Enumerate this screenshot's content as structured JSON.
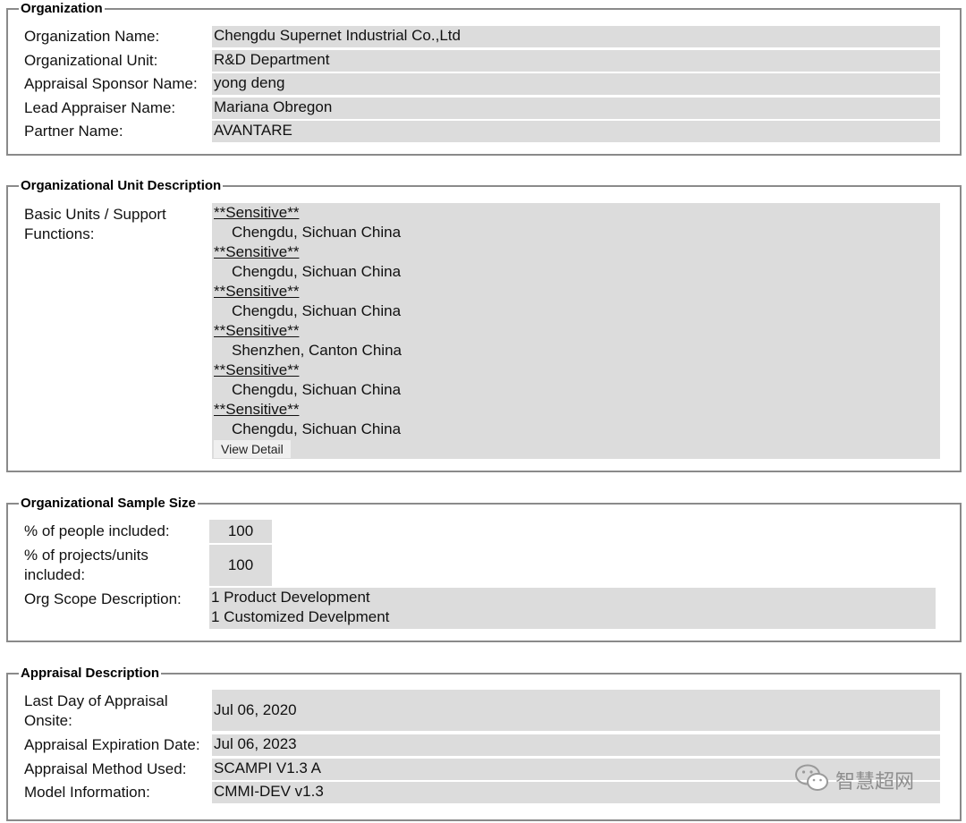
{
  "organization": {
    "legend": "Organization",
    "rows": [
      {
        "label": "Organization Name:",
        "value": "Chengdu Supernet Industrial Co.,Ltd"
      },
      {
        "label": "Organizational Unit:",
        "value": "R&D Department"
      },
      {
        "label": "Appraisal Sponsor Name:",
        "value": "yong deng"
      },
      {
        "label": "Lead Appraiser Name:",
        "value": "Mariana Obregon"
      },
      {
        "label": "Partner Name:",
        "value": "AVANTARE"
      }
    ]
  },
  "unit_description": {
    "legend": "Organizational Unit Description",
    "label": "Basic Units / Support Functions:",
    "units": [
      {
        "name": "**Sensitive**",
        "location": "Chengdu, Sichuan China"
      },
      {
        "name": "**Sensitive**",
        "location": "Chengdu, Sichuan China"
      },
      {
        "name": "**Sensitive**",
        "location": "Chengdu, Sichuan China"
      },
      {
        "name": "**Sensitive**",
        "location": "Shenzhen, Canton China"
      },
      {
        "name": "**Sensitive**",
        "location": "Chengdu, Sichuan China"
      },
      {
        "name": "**Sensitive**",
        "location": "Chengdu, Sichuan China"
      }
    ],
    "view_detail_label": "View Detail"
  },
  "sample_size": {
    "legend": "Organizational Sample Size",
    "people_label": "% of people included:",
    "people_value": "100",
    "projects_label": "% of projects/units included:",
    "projects_value": "100",
    "scope_label": "Org Scope Description:",
    "scope_lines": [
      "1 Product Development",
      "1 Customized Develpment"
    ]
  },
  "appraisal": {
    "legend": "Appraisal Description",
    "rows": [
      {
        "label": "Last Day of Appraisal Onsite:",
        "value": "Jul 06, 2020"
      },
      {
        "label": "Appraisal Expiration Date:",
        "value": "Jul 06, 2023"
      },
      {
        "label": "Appraisal Method Used:",
        "value": "SCAMPI V1.3 A"
      },
      {
        "label": "Model Information:",
        "value": "CMMI-DEV v1.3"
      }
    ]
  },
  "watermark": {
    "text": "智慧超网",
    "icon": "wechat-icon"
  }
}
